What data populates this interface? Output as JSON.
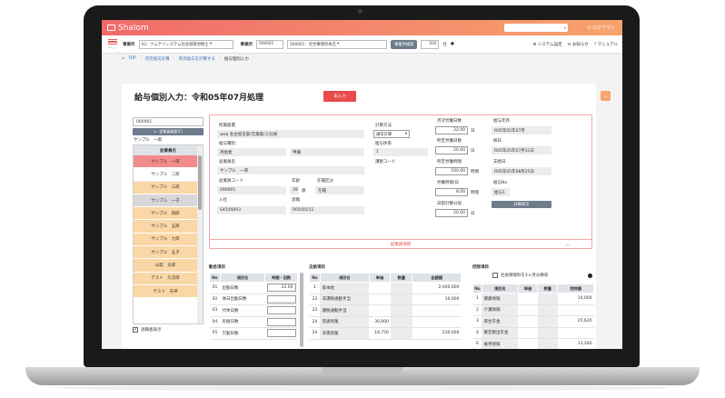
{
  "app": {
    "logo_text": "Shalom",
    "logout_label": "ログアウト",
    "header_select_value": "▾"
  },
  "toolbar": {
    "menu_label": "メニュー",
    "office_label": "事業所",
    "office_value": "02：ナムテイシステム社会保険労務士",
    "business_label": "事業所",
    "business_code": "000001",
    "business_name": "000001：社労事務所本店",
    "business_search_button": "事業所検索",
    "count_value": "500",
    "count_unit": "社",
    "links": [
      "システム設定",
      "お知らせ",
      "マニュアル"
    ]
  },
  "breadcrumb": {
    "items": [
      "TOP",
      "月次給与計算",
      "月次給与を計算する",
      "給与個別入力"
    ]
  },
  "page": {
    "title": "給与個別入力：令和05年07月処理",
    "status_button": "未入力",
    "collapse_icon": "chevron-down"
  },
  "employee_panel": {
    "search_value": "000001",
    "search_button": "従業員検索(F)",
    "current_name": "サンプル　一郎",
    "list_header": "従業員名",
    "employees": [
      {
        "name": "サンプル　一郎",
        "state": "sel"
      },
      {
        "name": "サンプル　二郎",
        "state": "white"
      },
      {
        "name": "サンプル　三郎",
        "state": ""
      },
      {
        "name": "サンプル　一子",
        "state": "gray"
      },
      {
        "name": "サンプル　四郎",
        "state": ""
      },
      {
        "name": "サンプル　五郎",
        "state": ""
      },
      {
        "name": "サンプル　七郎",
        "state": ""
      },
      {
        "name": "サンプル　五子",
        "state": ""
      },
      {
        "name": "山梨　太郎",
        "state": ""
      },
      {
        "name": "テスト　久次郎",
        "state": ""
      },
      {
        "name": "テスト　天神",
        "state": ""
      }
    ],
    "retired_label": "退職者表示",
    "retired_checked": "✓"
  },
  "info": {
    "dept_label": "所属部署",
    "dept_value": "web 名古屋支部/営業部/三社員",
    "salary_type_label": "給与種別",
    "salary_type_value": "月給者",
    "salary_type_value2": "甲欄",
    "employee_name_label": "従業員名",
    "employee_name_value": "サンプル　一郎",
    "employee_code_label": "従業員コード",
    "employee_code_value": "000001",
    "age_label": "年齢",
    "age_value": "39",
    "age_unit": "歳",
    "status_label": "在籍区分",
    "status_value": "在籍",
    "hire_label": "入社",
    "hire_value": "S45/08/03",
    "retire_label": "退職",
    "retire_value": "R05/05/11",
    "calc_method_label": "計算方法",
    "calc_method_value": "通常計算",
    "pay_system_label": "給与体系",
    "pay_system_value": "1",
    "tax_code_label": "課税コード",
    "base_days_label": "月次労働日数",
    "base_days_value": "22.00",
    "base_days_unit": "日",
    "fixed_days_label": "所定労働日数",
    "fixed_days_value": "20.00",
    "fixed_days_unit": "日",
    "fixed_hours_label": "所定労働時間",
    "fixed_hours_value": "160.00",
    "fixed_hours_unit": "時間",
    "daily_hours_label": "労働時間/日",
    "daily_hours_value": "8.00",
    "daily_hours_unit": "時間",
    "daily_calc_label": "日割計算分母",
    "daily_calc_value": "20.00",
    "daily_calc_unit": "日",
    "pay_month_label": "給与年月",
    "pay_month_value": "R05年05年07月",
    "close_label": "締日",
    "close_value": "R05年05年07月31日",
    "payday_label": "支給日",
    "payday_value": "R05年05年08月25日",
    "salary_no_label": "給与No",
    "salary_no_value": "給与1",
    "detail_button": "詳細表示",
    "footer_label": "従業員項目",
    "footer_caret": "︿"
  },
  "attendance": {
    "title": "勤怠項目",
    "headers": [
      "No",
      "項目名",
      "時間・回数"
    ],
    "rows": [
      {
        "no": "01",
        "name": "出勤日数",
        "value": "22.00"
      },
      {
        "no": "02",
        "name": "休日出勤日数",
        "value": ""
      },
      {
        "no": "03",
        "name": "代休日数",
        "value": ""
      },
      {
        "no": "04",
        "name": "有給日数",
        "value": ""
      },
      {
        "no": "05",
        "name": "欠勤日数",
        "value": ""
      }
    ]
  },
  "payments": {
    "title": "支給項目",
    "headers": [
      "No",
      "項目名",
      "単価",
      "数量",
      "金額額"
    ],
    "rows": [
      {
        "no": "1",
        "name": "基本給",
        "unit": "",
        "qty": "",
        "amount": "2,000,000"
      },
      {
        "no": "23",
        "name": "非課税通勤手当",
        "unit": "",
        "qty": "",
        "amount": "10,000"
      },
      {
        "no": "23",
        "name": "課税通勤手当",
        "unit": "",
        "qty": "",
        "amount": ""
      },
      {
        "no": "24",
        "name": "普通残業",
        "unit": "30,000",
        "qty": "",
        "amount": ""
      },
      {
        "no": "24",
        "name": "深夜残業",
        "unit": "18,750",
        "qty": "",
        "amount": "230,000"
      }
    ]
  },
  "deductions": {
    "title": "控除項目",
    "social_insurance_label": "社会保険料を2ヶ月分徴収",
    "headers": [
      "No",
      "項目名",
      "単価",
      "数量",
      "控除額"
    ],
    "rows": [
      {
        "no": "1",
        "name": "健康保険",
        "unit": "",
        "qty": "",
        "amount": "14,000"
      },
      {
        "no": "2",
        "name": "介護保険",
        "unit": "",
        "qty": "",
        "amount": ""
      },
      {
        "no": "3",
        "name": "厚生年金",
        "unit": "",
        "qty": "",
        "amount": "25,620"
      },
      {
        "no": "4",
        "name": "確定拠出年金",
        "unit": "",
        "qty": "",
        "amount": ""
      },
      {
        "no": "6",
        "name": "雇用保険",
        "unit": "",
        "qty": "",
        "amount": "13,260"
      }
    ]
  }
}
